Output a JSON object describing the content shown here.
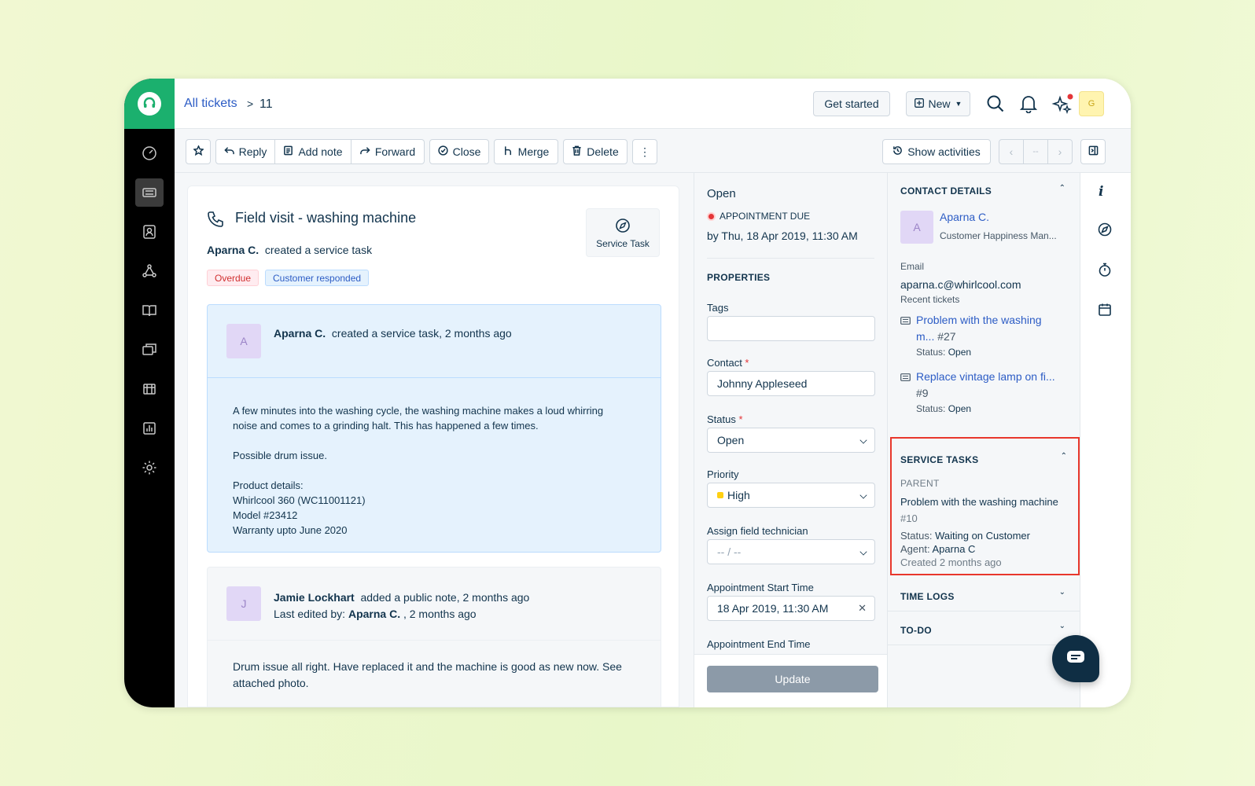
{
  "breadcrumb": {
    "link": "All tickets",
    "separator": ">",
    "current": "11"
  },
  "header": {
    "get_started": "Get started",
    "new_label": "New",
    "avatar_initial": "G"
  },
  "toolbar": {
    "reply": "Reply",
    "add_note": "Add note",
    "forward": "Forward",
    "close": "Close",
    "merge": "Merge",
    "delete": "Delete",
    "show_activities": "Show activities",
    "pager_middle": "--"
  },
  "ticket": {
    "title": "Field visit - washing machine",
    "creator": "Aparna C.",
    "creator_action": "created a service task",
    "tags": [
      "Overdue",
      "Customer responded"
    ],
    "type_label": "Service Task"
  },
  "messages": [
    {
      "avatar": "A",
      "author": "Aparna C.",
      "meta": "created a service task, 2 months ago",
      "body": [
        "A few minutes into the washing cycle, the washing machine makes a loud whirring",
        "noise and comes to a grinding halt. This has happened a few times.",
        "Possible drum issue.",
        "Product details:",
        "Whirlcool 360 (WC11001121)",
        "Model #23412",
        "Warranty upto June 2020"
      ]
    },
    {
      "avatar": "J",
      "author": "Jamie Lockhart",
      "meta": "added a public note, 2 months ago",
      "edited_prefix": "Last edited by:",
      "edited_by": "Aparna C.",
      "edited_suffix": ", 2 months ago",
      "body": [
        "Drum issue all right. Have replaced it and the machine is good as new now. See",
        "attached photo."
      ]
    }
  ],
  "properties": {
    "status_heading": "Open",
    "appointment_due_label": "APPOINTMENT DUE",
    "appointment_due_value": "by Thu, 18 Apr 2019, 11:30 AM",
    "section_title": "PROPERTIES",
    "tags_label": "Tags",
    "tags_value": "",
    "contact_label": "Contact",
    "contact_value": "Johnny Appleseed",
    "status_label": "Status",
    "status_value": "Open",
    "priority_label": "Priority",
    "priority_value": "High",
    "priority_color": "#ffd012",
    "technician_label": "Assign field technician",
    "technician_value": "-- / --",
    "start_label": "Appointment Start Time",
    "start_value": "18 Apr 2019, 11:30 AM",
    "end_label": "Appointment End Time",
    "update_button": "Update"
  },
  "contact": {
    "section_title": "CONTACT DETAILS",
    "avatar": "A",
    "name": "Aparna C.",
    "role": "Customer Happiness Man...",
    "email_label": "Email",
    "email": "aparna.c@whirlcool.com",
    "recent_label": "Recent tickets",
    "recent": [
      {
        "line1": "Problem with the washing",
        "line2_link": "m...",
        "line2_num": "#27",
        "status_label": "Status:",
        "status": "Open"
      },
      {
        "line1": "Replace vintage lamp on fi...",
        "line2_num": "#9",
        "status_label": "Status:",
        "status": "Open"
      }
    ]
  },
  "service_tasks": {
    "section_title": "SERVICE TASKS",
    "parent_label": "PARENT",
    "parent_title": "Problem with the washing machine",
    "parent_num": "#10",
    "status_label": "Status:",
    "status": "Waiting on Customer",
    "agent_label": "Agent:",
    "agent": "Aparna C",
    "created": "Created 2 months ago",
    "highlight_color": "#e8372c"
  },
  "collapsed_sections": {
    "time_logs": "TIME LOGS",
    "todo": "TO-DO"
  },
  "colors": {
    "brand": "#1bb06e",
    "link": "#2c5cc5",
    "sidebar": "#000000"
  }
}
